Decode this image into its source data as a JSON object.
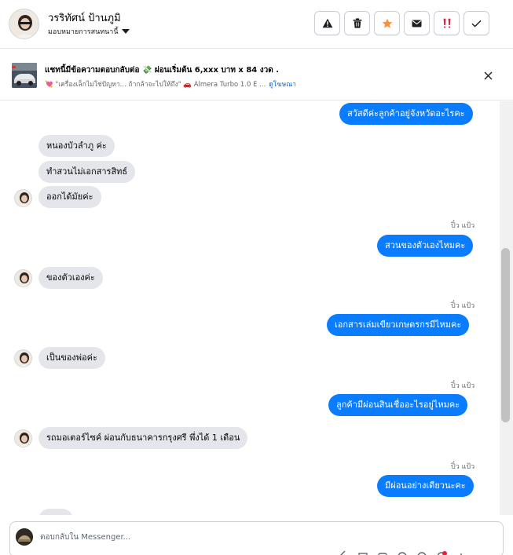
{
  "header": {
    "contact_name": "วรริทัศน์ ป้านภูมิ",
    "assign_label": "มอบหมายการสนทนานี้",
    "actions": [
      {
        "name": "report-spam-button",
        "icon": "warning-icon"
      },
      {
        "name": "delete-button",
        "icon": "trash-icon"
      },
      {
        "name": "star-button",
        "icon": "star-icon"
      },
      {
        "name": "mark-unread-button",
        "icon": "envelope-icon"
      },
      {
        "name": "follow-up-button",
        "icon": "important-icon"
      },
      {
        "name": "mark-done-button",
        "icon": "check-icon"
      }
    ]
  },
  "ad": {
    "title": "แชทนี้มีข้อความตอบกลับต่อ 💸 ผ่อนเริ่มต้น 6,xxx บาท x 84 งวด .",
    "subtitle": "💘 \"เครื่องเล็กไม่ใช่ปัญหา... ถ้ากล้าจะไปให้ถึง\" 🚗 Almera Turbo 1.0 E ...",
    "link": "ดูโฆษณา"
  },
  "messages": [
    {
      "side": "out",
      "text": "สวัสดีค่ะลูกค้าอยู่จังหวัดอะไรคะ"
    },
    {
      "side": "in",
      "text": "หนองบัวลำภู ค่ะ"
    },
    {
      "side": "in",
      "text": "ทำสวนไม่เอกสารสิทธ์"
    },
    {
      "side": "in",
      "text": "ออกได้มัยค่ะ"
    },
    {
      "side": "out",
      "sender": "ปิ๋ว แป้ว",
      "text": "สวนของตัวเองไหมคะ"
    },
    {
      "side": "in",
      "text": "ของตัวเองค่ะ"
    },
    {
      "side": "out",
      "sender": "ปิ๋ว แป้ว",
      "text": "เอกสารเล่มเขียวเกษตรกรมีไหมคะ"
    },
    {
      "side": "in",
      "text": "เป็นของพ่อค่ะ"
    },
    {
      "side": "out",
      "sender": "ปิ๋ว แป้ว",
      "text": "ลูกค้ามีผ่อนสินเชื่ออะไรอยู่ไหมคะ"
    },
    {
      "side": "in",
      "text": "รถมอเตอร์ไซค์ ผ่อนกับธนาคารกรุงศรี พึ่งได้ 1 เดือน"
    },
    {
      "side": "out",
      "sender": "ปิ๋ว แป้ว",
      "text": "มีผ่อนอย่างเดียวนะคะ"
    }
  ],
  "composer": {
    "placeholder": "ตอบกลับใน Messenger..."
  },
  "colors": {
    "outgoing_bubble": "#0a7cff",
    "incoming_bubble": "#e4e6eb",
    "star_accent": "#f7923b",
    "important_accent": "#e41e3f"
  }
}
